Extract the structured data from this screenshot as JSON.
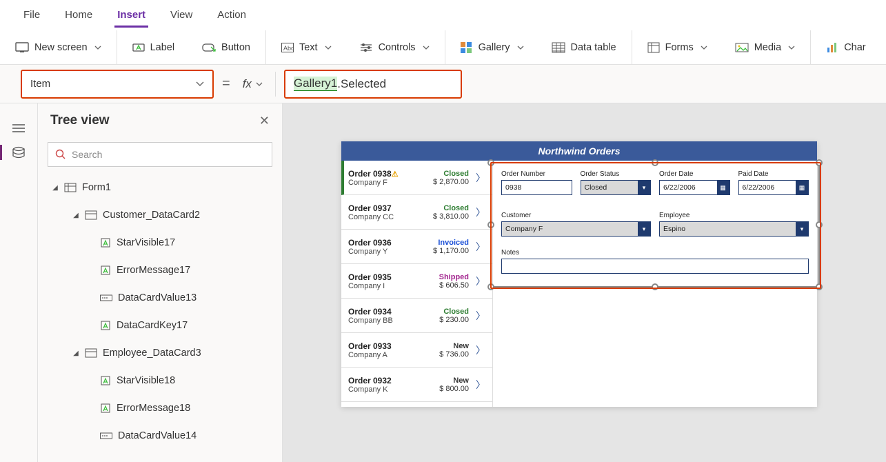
{
  "menubar": {
    "items": [
      "File",
      "Home",
      "Insert",
      "View",
      "Action"
    ],
    "active": "Insert"
  },
  "ribbon": {
    "new_screen": "New screen",
    "label": "Label",
    "button": "Button",
    "text": "Text",
    "controls": "Controls",
    "gallery": "Gallery",
    "data_table": "Data table",
    "forms": "Forms",
    "media": "Media",
    "chart": "Char"
  },
  "formula": {
    "property": "Item",
    "gallery_ref": "Gallery1",
    "suffix": ".Selected"
  },
  "tree": {
    "title": "Tree view",
    "search_placeholder": "Search",
    "items": [
      {
        "level": 1,
        "kind": "form",
        "label": "Form1",
        "expanded": true
      },
      {
        "level": 2,
        "kind": "card",
        "label": "Customer_DataCard2",
        "expanded": true
      },
      {
        "level": 3,
        "kind": "ctrl",
        "label": "StarVisible17"
      },
      {
        "level": 3,
        "kind": "ctrl",
        "label": "ErrorMessage17"
      },
      {
        "level": 3,
        "kind": "val",
        "label": "DataCardValue13"
      },
      {
        "level": 3,
        "kind": "ctrl",
        "label": "DataCardKey17"
      },
      {
        "level": 2,
        "kind": "card",
        "label": "Employee_DataCard3",
        "expanded": true
      },
      {
        "level": 3,
        "kind": "ctrl",
        "label": "StarVisible18"
      },
      {
        "level": 3,
        "kind": "ctrl",
        "label": "ErrorMessage18"
      },
      {
        "level": 3,
        "kind": "val",
        "label": "DataCardValue14"
      }
    ]
  },
  "app": {
    "title": "Northwind Orders",
    "gallery": [
      {
        "order": "Order 0938",
        "warn": true,
        "company": "Company F",
        "status": "Closed",
        "status_cls": "st-closed",
        "price": "$ 2,870.00",
        "sel": true
      },
      {
        "order": "Order 0937",
        "company": "Company CC",
        "status": "Closed",
        "status_cls": "st-closed",
        "price": "$ 3,810.00"
      },
      {
        "order": "Order 0936",
        "company": "Company Y",
        "status": "Invoiced",
        "status_cls": "st-invoiced",
        "price": "$ 1,170.00"
      },
      {
        "order": "Order 0935",
        "company": "Company I",
        "status": "Shipped",
        "status_cls": "st-shipped",
        "price": "$ 606.50"
      },
      {
        "order": "Order 0934",
        "company": "Company BB",
        "status": "Closed",
        "status_cls": "st-closed",
        "price": "$ 230.00"
      },
      {
        "order": "Order 0933",
        "company": "Company A",
        "status": "New",
        "status_cls": "st-new",
        "price": "$ 736.00"
      },
      {
        "order": "Order 0932",
        "company": "Company K",
        "status": "New",
        "status_cls": "st-new",
        "price": "$ 800.00"
      }
    ],
    "form": {
      "order_number": {
        "label": "Order Number",
        "value": "0938"
      },
      "order_status": {
        "label": "Order Status",
        "value": "Closed"
      },
      "order_date": {
        "label": "Order Date",
        "value": "6/22/2006"
      },
      "paid_date": {
        "label": "Paid Date",
        "value": "6/22/2006"
      },
      "customer": {
        "label": "Customer",
        "value": "Company F"
      },
      "employee": {
        "label": "Employee",
        "value": "Espino"
      },
      "notes": {
        "label": "Notes",
        "value": ""
      }
    }
  }
}
